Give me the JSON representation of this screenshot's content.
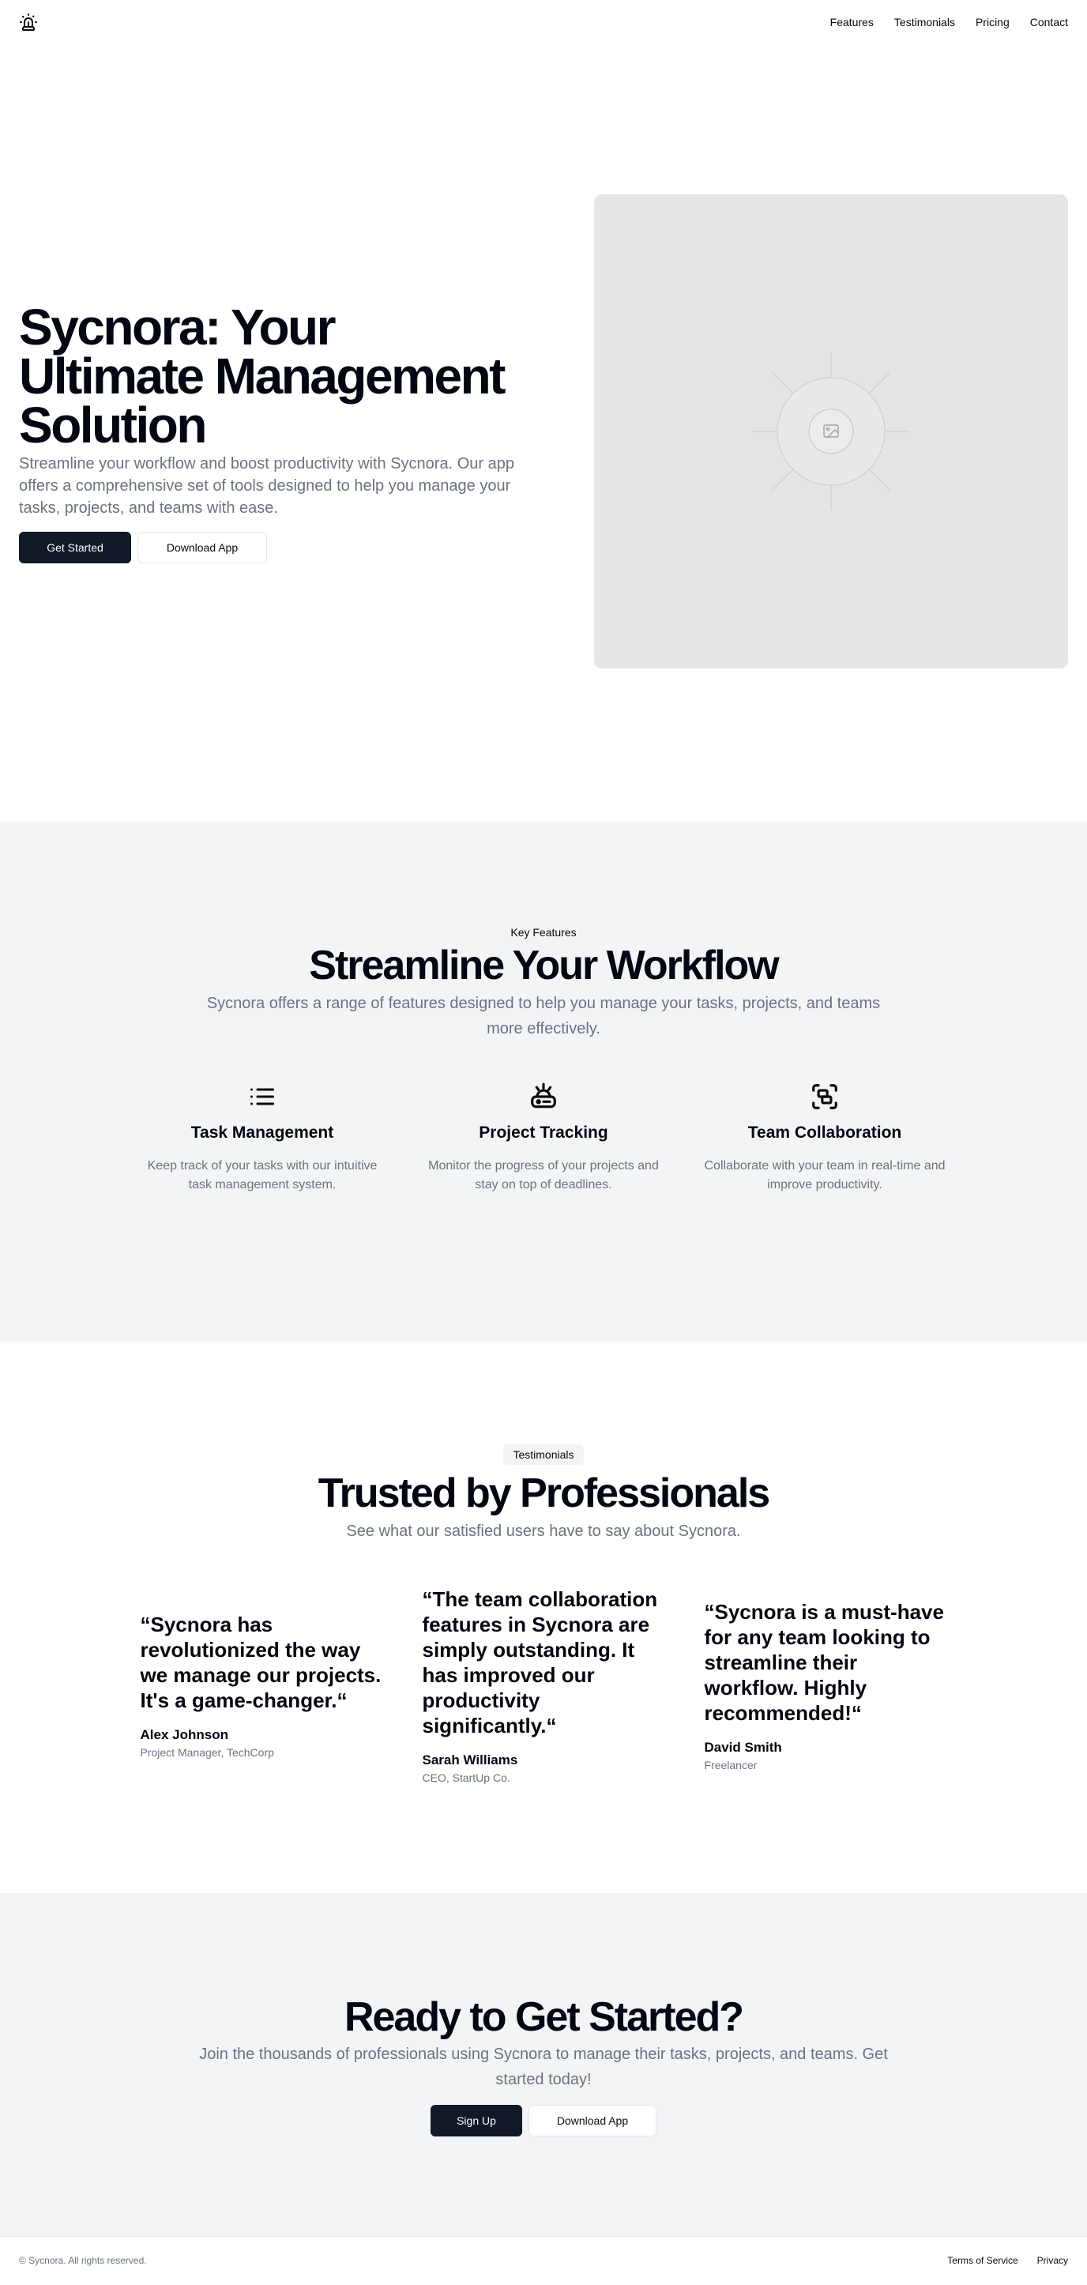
{
  "nav": {
    "logo_icon": "alarm-light-icon",
    "links": [
      {
        "label": "Features"
      },
      {
        "label": "Testimonials"
      },
      {
        "label": "Pricing"
      },
      {
        "label": "Contact"
      }
    ]
  },
  "hero": {
    "title": "Sycnora: Your Ultimate Management Solution",
    "subtitle": "Streamline your workflow and boost productivity with Sycnora. Our app offers a comprehensive set of tools designed to help you manage your tasks, projects, and teams with ease.",
    "primary_button": "Get Started",
    "secondary_button": "Download App",
    "image_icon": "image-placeholder-icon"
  },
  "features": {
    "label": "Key Features",
    "title": "Streamline Your Workflow",
    "subtitle": "Sycnora offers a range of features designed to help you manage your tasks, projects, and teams more effectively.",
    "items": [
      {
        "icon": "list-icon",
        "title": "Task Management",
        "description": "Keep track of your tasks with our intuitive task management system."
      },
      {
        "icon": "alarm-tracking-icon",
        "title": "Project Tracking",
        "description": "Monitor the progress of your projects and stay on top of deadlines."
      },
      {
        "icon": "group-icon",
        "title": "Team Collaboration",
        "description": "Collaborate with your team in real-time and improve productivity."
      }
    ]
  },
  "testimonials": {
    "badge": "Testimonials",
    "title": "Trusted by Professionals",
    "subtitle": "See what our satisfied users have to say about Sycnora.",
    "items": [
      {
        "quote": "“Sycnora has revolutionized the way we manage our projects. It's a game-changer.“",
        "name": "Alex Johnson",
        "role": "Project Manager, TechCorp"
      },
      {
        "quote": "“The team collaboration features in Sycnora are simply outstanding. It has improved our productivity significantly.“",
        "name": "Sarah Williams",
        "role": "CEO, StartUp Co."
      },
      {
        "quote": "“Sycnora is a must-have for any team looking to streamline their workflow. Highly recommended!“",
        "name": "David Smith",
        "role": "Freelancer"
      }
    ]
  },
  "cta": {
    "title": "Ready to Get Started?",
    "subtitle": "Join the thousands of professionals using Sycnora to manage their tasks, projects, and teams. Get started today!",
    "primary_button": "Sign Up",
    "secondary_button": "Download App"
  },
  "footer": {
    "copyright": "© Sycnora. All rights reserved.",
    "links": [
      {
        "label": "Terms of Service"
      },
      {
        "label": "Privacy"
      }
    ]
  },
  "colors": {
    "primary": "#111827",
    "muted_text": "#6b7280",
    "section_bg": "#f3f4f6",
    "placeholder_bg": "#e5e5e5"
  }
}
